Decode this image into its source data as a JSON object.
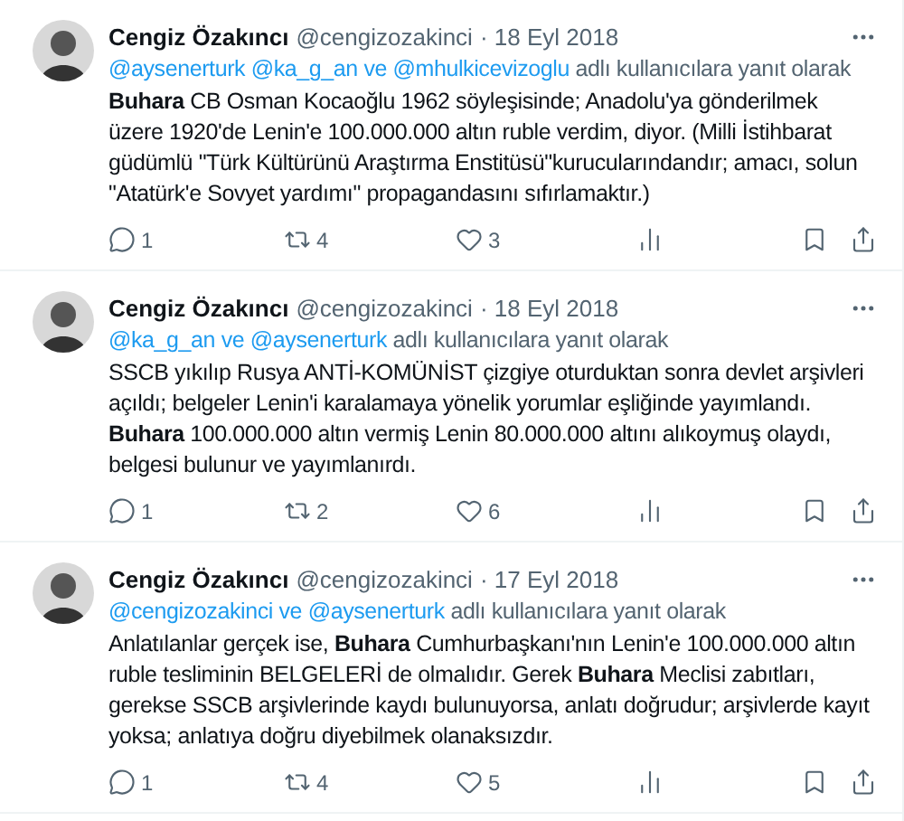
{
  "tweets": [
    {
      "name": "Cengiz Özakıncı",
      "handle": "@cengizozakinci",
      "date": "· 18 Eyl 2018",
      "reply_to": {
        "mentions": "@aysenerturk @ka_g_an ve @mhulkicevizoglu",
        "suffix": "adlı kullanıcılara yanıt olarak"
      },
      "text": "**Buhara** CB Osman Kocaoğlu 1962 söyleşisinde; Anadolu'ya gönderilmek üzere 1920'de Lenin'e 100.000.000 altın ruble verdim, diyor. (Milli İstihbarat güdümlü \"Türk Kültürünü Araştırma Enstitüsü\"kurucularındandır; amacı, solun \"Atatürk'e Sovyet yardımı\" propagandasını sıfırlamaktır.)",
      "replies": "1",
      "retweets": "4",
      "likes": "3"
    },
    {
      "name": "Cengiz Özakıncı",
      "handle": "@cengizozakinci",
      "date": "· 18 Eyl 2018",
      "reply_to": {
        "mentions": "@ka_g_an ve @aysenerturk",
        "suffix": "adlı kullanıcılara yanıt olarak"
      },
      "text": "SSCB yıkılıp Rusya ANTİ-KOMÜNİST çizgiye oturduktan sonra devlet arşivleri açıldı; belgeler Lenin'i karalamaya yönelik yorumlar eşliğinde yayımlandı. **Buhara** 100.000.000 altın vermiş Lenin 80.000.000 altını alıkoymuş olaydı, belgesi bulunur ve yayımlanırdı.",
      "replies": "1",
      "retweets": "2",
      "likes": "6"
    },
    {
      "name": "Cengiz Özakıncı",
      "handle": "@cengizozakinci",
      "date": "· 17 Eyl 2018",
      "reply_to": {
        "mentions": "@cengizozakinci ve @aysenerturk",
        "suffix": "adlı kullanıcılara yanıt olarak"
      },
      "text": "Anlatılanlar gerçek ise, **Buhara** Cumhurbaşkanı'nın Lenin'e 100.000.000 altın ruble tesliminin BELGELERİ de olmalıdır. Gerek **Buhara** Meclisi zabıtları, gerekse SSCB arşivlerinde kaydı bulunuyorsa, anlatı doğrudur; arşivlerde kayıt yoksa; anlatıya doğru diyebilmek olanaksızdır.",
      "replies": "1",
      "retweets": "4",
      "likes": "5"
    }
  ]
}
